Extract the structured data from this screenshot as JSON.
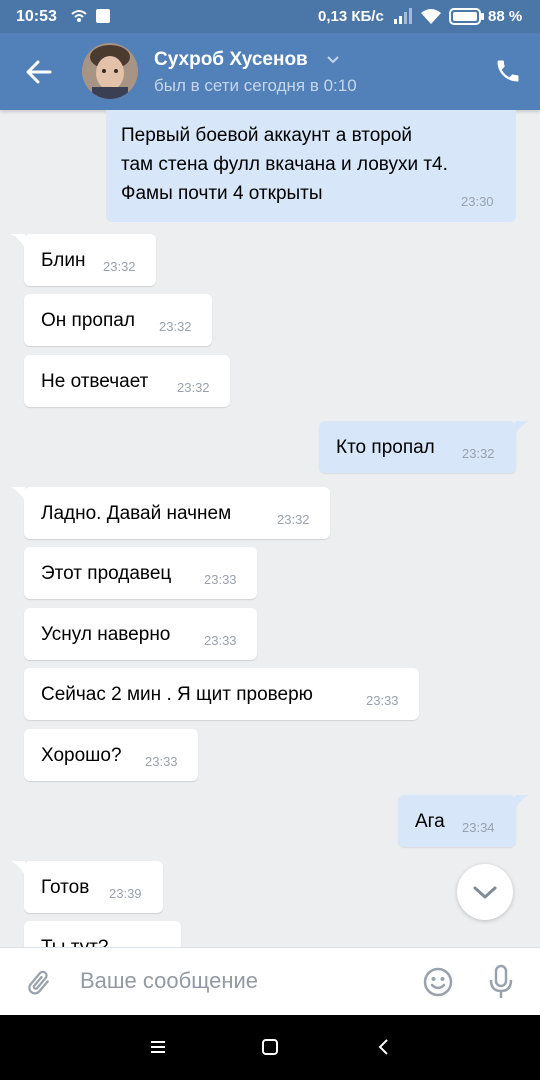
{
  "status_bar": {
    "time": "10:53",
    "network_speed": "0,13 КБ/с",
    "battery": "88 %"
  },
  "header": {
    "contact_name": "Сухроб Хусенов",
    "contact_status": "был в сети сегодня в 0:10"
  },
  "first_message": {
    "lines": [
      "Первый боевой аккаунт а второй",
      "там стена фулл вкачана и ловухи т4.",
      "Фамы почти 4 открыты"
    ],
    "time": "23:30"
  },
  "messages": [
    {
      "text": "Блин",
      "time": "23:32",
      "dir": "in"
    },
    {
      "text": "Он пропал",
      "time": "23:32",
      "dir": "in"
    },
    {
      "text": "Не отвечает",
      "time": "23:32",
      "dir": "in"
    },
    {
      "text": "Кто пропал",
      "time": "23:32",
      "dir": "out"
    },
    {
      "text": "Ладно. Давай начнем",
      "time": "23:32",
      "dir": "in"
    },
    {
      "text": "Этот продавец",
      "time": "23:33",
      "dir": "in"
    },
    {
      "text": "Уснул наверно",
      "time": "23:33",
      "dir": "in"
    },
    {
      "text": "Сейчас 2 мин . Я щит проверю",
      "time": "23:33",
      "dir": "in"
    },
    {
      "text": "Хорошо?",
      "time": "23:33",
      "dir": "in"
    },
    {
      "text": "Ага",
      "time": "23:34",
      "dir": "out"
    },
    {
      "text": "Готов",
      "time": "23:39",
      "dir": "in"
    },
    {
      "text": "Ты тут?",
      "time": "",
      "dir": "in"
    }
  ],
  "composer": {
    "placeholder": "Ваше сообщение"
  },
  "icons": {
    "back": "arrow-back-icon",
    "call": "phone-icon",
    "attach": "paperclip-icon",
    "emoji": "smiley-icon",
    "mic": "microphone-icon",
    "scroll": "chevron-down-icon"
  },
  "colors": {
    "header": "#5181b8",
    "status_bar": "#4a76a8",
    "outgoing_bubble": "#d7e6f8",
    "incoming_bubble": "#ffffff",
    "chat_bg": "#edeef0"
  }
}
